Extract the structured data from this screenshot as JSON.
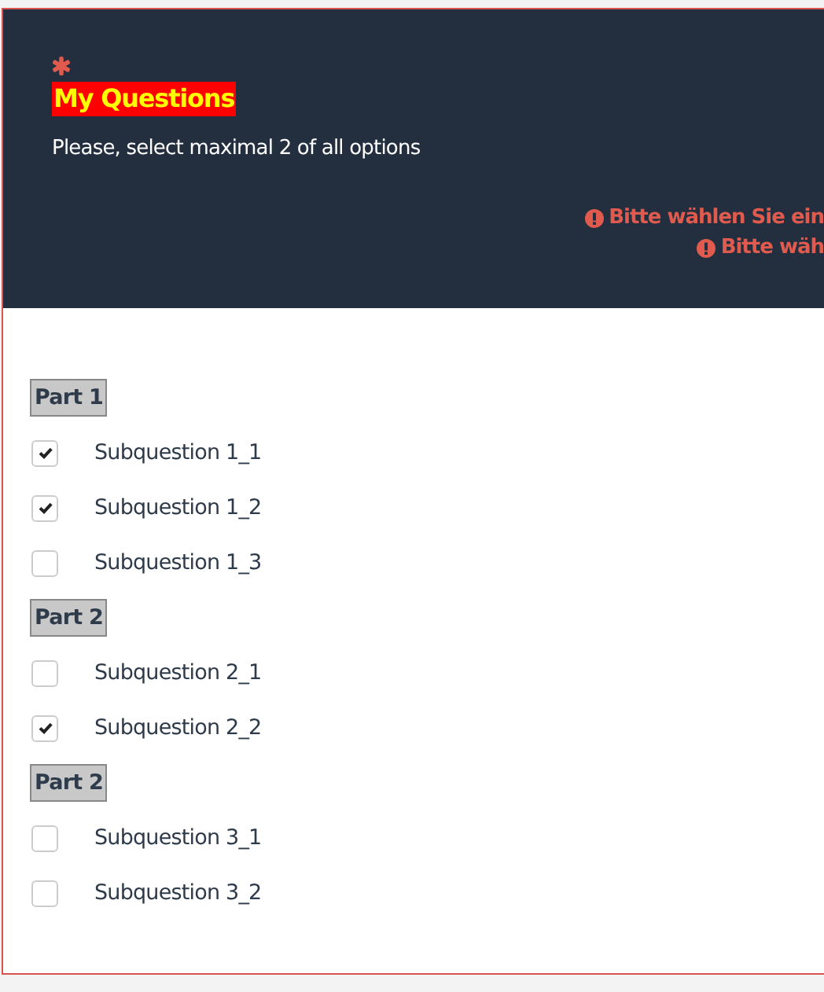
{
  "question": {
    "required": true,
    "title": "My Questions",
    "help": "Please, select maximal 2 of all options",
    "errors": [
      "Bitte wählen Sie ein",
      "Bitte wäh"
    ]
  },
  "groups": [
    {
      "label": "Part 1",
      "options": [
        {
          "label": "Subquestion 1_1",
          "checked": true
        },
        {
          "label": "Subquestion 1_2",
          "checked": true
        },
        {
          "label": "Subquestion 1_3",
          "checked": false
        }
      ]
    },
    {
      "label": "Part 2",
      "options": [
        {
          "label": "Subquestion 2_1",
          "checked": false
        },
        {
          "label": "Subquestion 2_2",
          "checked": true
        }
      ]
    },
    {
      "label": "Part 2",
      "options": [
        {
          "label": "Subquestion 3_1",
          "checked": false
        },
        {
          "label": "Subquestion 3_2",
          "checked": false
        }
      ]
    }
  ]
}
